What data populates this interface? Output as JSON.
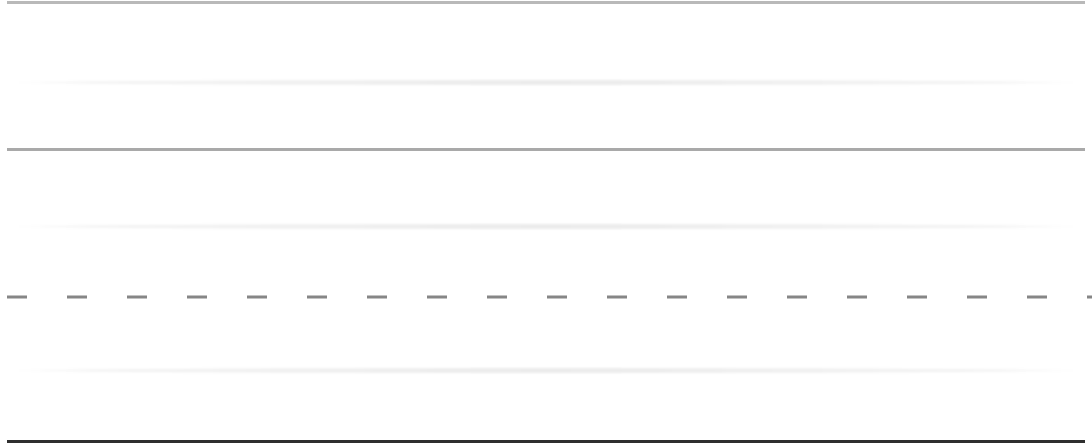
{
  "dividers": [
    {
      "style": "solid",
      "color": "#b9b9b9"
    },
    {
      "style": "faded",
      "color": "#e3e3e3"
    },
    {
      "style": "solid",
      "color": "#a9a9a9"
    },
    {
      "style": "faded",
      "color": "#e3e3e3"
    },
    {
      "style": "dashed",
      "color": "#868686"
    },
    {
      "style": "faded",
      "color": "#e3e3e3"
    },
    {
      "style": "solid",
      "color": "#2f2f2f"
    }
  ]
}
